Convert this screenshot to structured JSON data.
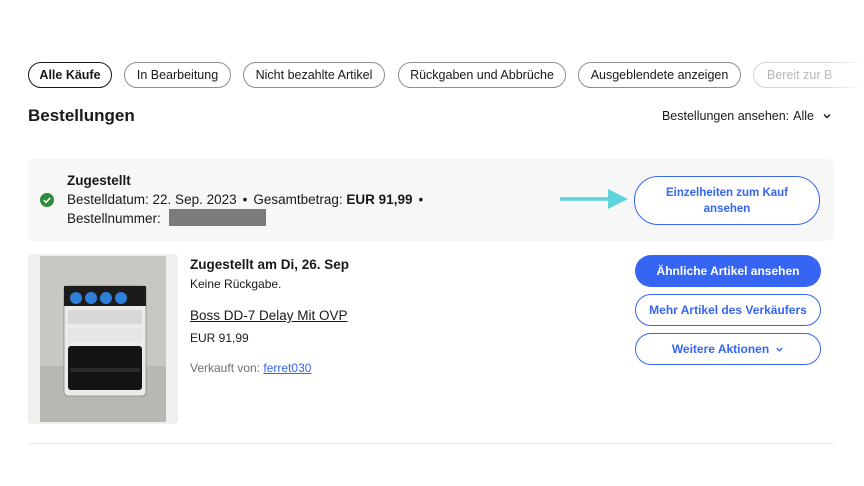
{
  "filters": [
    {
      "label": "Alle Käufe",
      "active": true
    },
    {
      "label": "In Bearbeitung",
      "active": false
    },
    {
      "label": "Nicht bezahlte Artikel",
      "active": false
    },
    {
      "label": "Rückgaben und Abbrüche",
      "active": false
    },
    {
      "label": "Ausgeblendete anzeigen",
      "active": false
    },
    {
      "label": "Bereit zur B",
      "active": false
    }
  ],
  "page": {
    "title": "Bestellungen",
    "view_label": "Bestellungen ansehen:",
    "view_value": "Alle",
    "view_icon": "chevron-down-icon"
  },
  "order": {
    "status": "Zugestellt",
    "status_icon": "check-circle-icon",
    "status_color": "#2e8b3d",
    "date_label": "Bestelldatum: 22. Sep. 2023",
    "total_label": "Gesamtbetrag:",
    "total_value": "EUR 91,99",
    "number_label": "Bestellnummer:",
    "details_button": "Einzelheiten zum Kauf ansehen",
    "arrow_icon": "arrow-right-icon",
    "arrow_color": "#5fd3dc"
  },
  "item": {
    "delivered": "Zugestellt am Di, 26. Sep",
    "return_policy": "Keine Rückgabe.",
    "title": "Boss DD-7 Delay Mit OVP",
    "price": "EUR 91,99",
    "sold_by_label": "Verkauft von:",
    "seller": "ferret030",
    "image_alt": "Boss DD-7 Digital Delay pedal"
  },
  "actions": {
    "similar": "Ähnliche Artikel ansehen",
    "more_from_seller": "Mehr Artikel des Verkäufers",
    "more_actions": "Weitere Aktionen",
    "accent": "#3665f3"
  }
}
